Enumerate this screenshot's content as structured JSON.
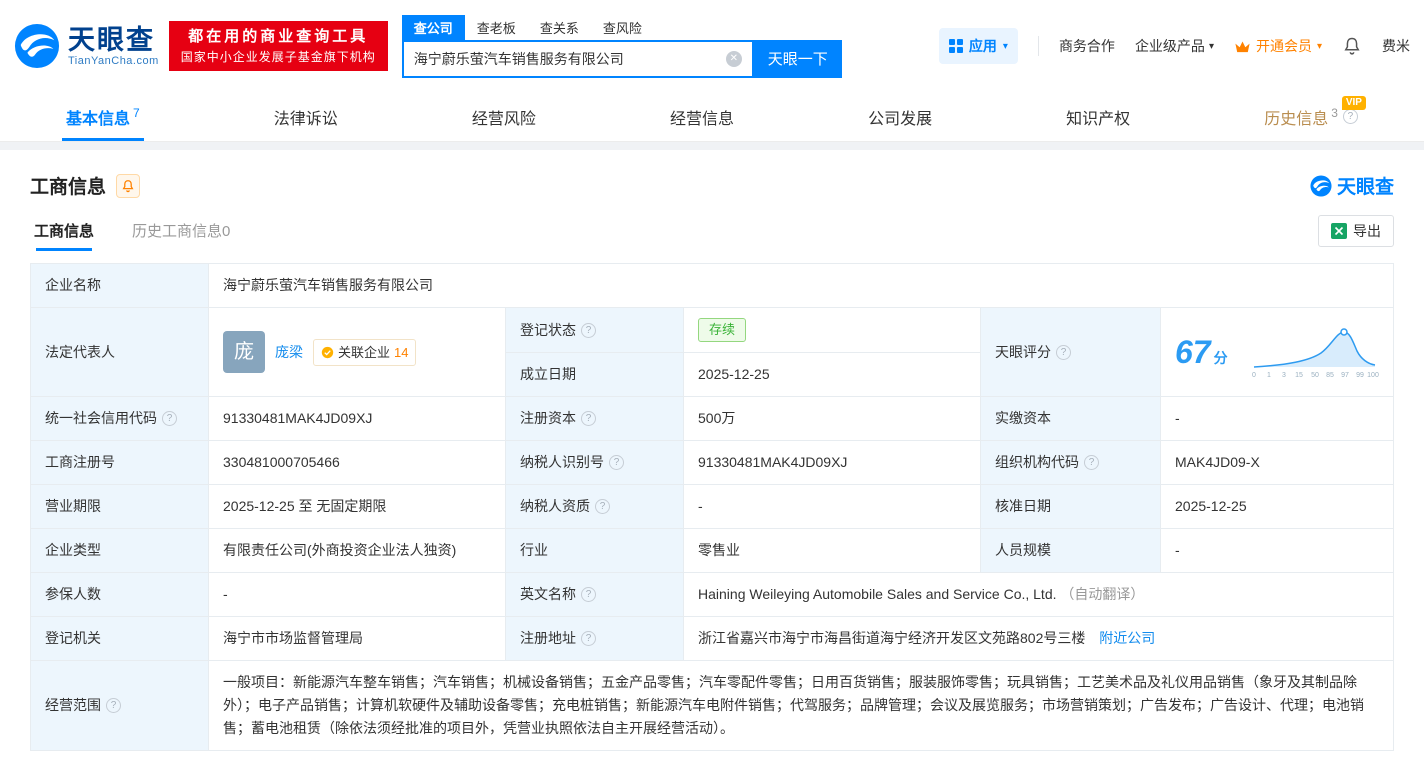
{
  "icons": {
    "help": "?",
    "clear": "✕",
    "caret_down": "▾"
  },
  "header": {
    "logo": {
      "brand": "天眼查",
      "domain": "TianYanCha.com"
    },
    "promo": {
      "line1": "都在用的商业查询工具",
      "line2": "国家中小企业发展子基金旗下机构"
    },
    "search": {
      "tabs": [
        {
          "label": "查公司"
        },
        {
          "label": "查老板"
        },
        {
          "label": "查关系"
        },
        {
          "label": "查风险"
        }
      ],
      "value": "海宁蔚乐萤汽车销售服务有限公司",
      "button_label": "天眼一下"
    },
    "right": {
      "apps_label": "应用",
      "cooperation_label": "商务合作",
      "enterprise_label": "企业级产品",
      "vip_label": "开通会员",
      "user_label": "费米"
    }
  },
  "nav": {
    "tabs": [
      {
        "label": "基本信息",
        "count": "7"
      },
      {
        "label": "法律诉讼"
      },
      {
        "label": "经营风险"
      },
      {
        "label": "经营信息"
      },
      {
        "label": "公司发展"
      },
      {
        "label": "知识产权"
      },
      {
        "label": "历史信息",
        "count": "3",
        "vip": "VIP"
      }
    ]
  },
  "section": {
    "title": "工商信息",
    "brand": "天眼查",
    "subtab_active": "工商信息",
    "subtab_history": "历史工商信息0",
    "export_label": "导出"
  },
  "table": {
    "company_name_label": "企业名称",
    "company_name": "海宁蔚乐萤汽车销售服务有限公司",
    "legal_rep_label": "法定代表人",
    "legal_rep_avatar": "庞",
    "legal_rep_name": "庞梁",
    "related_label": "关联企业",
    "related_count": "14",
    "reg_status_label": "登记状态",
    "reg_status": "存续",
    "establish_date_label": "成立日期",
    "establish_date": "2025-12-25",
    "score_label": "天眼评分",
    "score_value": "67",
    "score_unit": "分",
    "score_axis": [
      "0",
      "1",
      "3",
      "15",
      "50",
      "85",
      "97",
      "99",
      "100"
    ],
    "credit_code_label": "统一社会信用代码",
    "credit_code": "91330481MAK4JD09XJ",
    "reg_capital_label": "注册资本",
    "reg_capital": "500万",
    "paid_capital_label": "实缴资本",
    "paid_capital": "-",
    "reg_number_label": "工商注册号",
    "reg_number": "330481000705466",
    "taxpayer_id_label": "纳税人识别号",
    "taxpayer_id": "91330481MAK4JD09XJ",
    "org_code_label": "组织机构代码",
    "org_code": "MAK4JD09-X",
    "business_term_label": "营业期限",
    "business_term": "2025-12-25 至 无固定期限",
    "taxpayer_quality_label": "纳税人资质",
    "taxpayer_quality": "-",
    "approval_date_label": "核准日期",
    "approval_date": "2025-12-25",
    "company_type_label": "企业类型",
    "company_type": "有限责任公司(外商投资企业法人独资)",
    "industry_label": "行业",
    "industry": "零售业",
    "staff_size_label": "人员规模",
    "staff_size": "-",
    "insured_label": "参保人数",
    "insured": "-",
    "english_name_label": "英文名称",
    "english_name": "Haining Weileying Automobile Sales and Service Co., Ltd.",
    "english_name_note": "（自动翻译）",
    "registry_label": "登记机关",
    "registry": "海宁市市场监督管理局",
    "address_label": "注册地址",
    "address": "浙江省嘉兴市海宁市海昌街道海宁经济开发区文苑路802号三楼",
    "address_link": "附近公司",
    "business_scope_label": "经营范围",
    "business_scope": "一般项目：新能源汽车整车销售；汽车销售；机械设备销售；五金产品零售；汽车零配件零售；日用百货销售；服装服饰零售；玩具销售；工艺美术品及礼仪用品销售（象牙及其制品除外）；电子产品销售；计算机软硬件及辅助设备零售；充电桩销售；新能源汽车电附件销售；代驾服务；品牌管理；会议及展览服务；市场营销策划；广告发布；广告设计、代理；电池销售；蓄电池租赁（除依法须经批准的项目外，凭营业执照依法自主开展经营活动）。"
  }
}
